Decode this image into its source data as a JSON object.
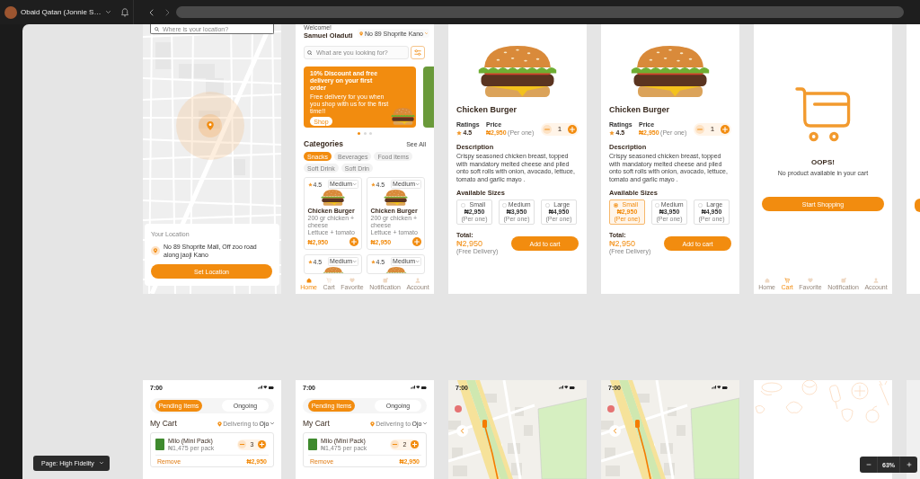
{
  "top_bar": {
    "account_name": "Obaid Qatan (Jonnie S…"
  },
  "top_row": [
    {
      "kind": "location",
      "search": {
        "placeholder": "Where is your location?"
      },
      "card": {
        "label": "Your Location",
        "address": "No 89 Shoprite Mall, Off zoo road along jaoji Kano",
        "button": "Set Location"
      }
    },
    {
      "kind": "home",
      "greeting": "Welcome!",
      "user_name": "Samuel Oladuti",
      "location": "No 89 Shoprite Kano",
      "search": {
        "placeholder": "What are you looking for?"
      },
      "banner": {
        "title": "10% Discount and free delivery on your first order",
        "subtitle": "Free delivery for you when you shop with us for the first time!!",
        "button": "Shop"
      },
      "banner_dots": [
        {
          "selected": true
        },
        {
          "selected": false
        },
        {
          "selected": false
        }
      ],
      "section_title": "Categories",
      "see_all": "See All",
      "categories": [
        {
          "label": "Snacks",
          "selected": true
        },
        {
          "label": "Beverages",
          "selected": false
        },
        {
          "label": "Food items",
          "selected": false
        },
        {
          "label": "Soft Drink",
          "selected": false
        },
        {
          "label": "Soft Drin",
          "selected": false
        }
      ],
      "products": [
        {
          "rating": "4.5",
          "size": "Medium",
          "name": "Chicken Burger",
          "details": [
            "200 gr chicken + cheese",
            "Lettuce + tomato"
          ],
          "price": "₦2,950"
        },
        {
          "rating": "4.5",
          "size": "Medium",
          "name": "Chicken Burger",
          "details": [
            "200 gr chicken + cheese",
            "Lettuce + tomato"
          ],
          "price": "₦2,950"
        },
        {
          "rating": "4.5",
          "size": "Medium"
        },
        {
          "rating": "4.5",
          "size": "Medium"
        }
      ],
      "nav": [
        {
          "label": "Home",
          "selected": true
        },
        {
          "label": "Cart",
          "selected": false
        },
        {
          "label": "Favorite",
          "selected": false
        },
        {
          "label": "Notification",
          "selected": false
        },
        {
          "label": "Account",
          "selected": false
        }
      ]
    },
    {
      "kind": "detail",
      "name": "Chicken Burger",
      "ratings_label": "Ratings",
      "rating": "4.5",
      "price_label": "Price",
      "price": "₦2,950",
      "price_unit": "(Per one)",
      "quantity": "1",
      "description_title": "Description",
      "description": "Crispy seasoned chicken breast, topped with mandatory melted cheese and piled onto soft rolls with onion, avocado, lettuce, tomato and garlic mayo .",
      "sizes_title": "Available Sizes",
      "sizes": [
        {
          "label": "Small",
          "price": "₦2,950",
          "unit": "(Per one)",
          "selected": false
        },
        {
          "label": "Medium",
          "price": "₦3,950",
          "unit": "(Per one)",
          "selected": false
        },
        {
          "label": "Large",
          "price": "₦4,950",
          "unit": "(Per one)",
          "selected": false
        }
      ],
      "total_label": "Total:",
      "total": "₦2,950",
      "delivery_note": "(Free Delivery)",
      "button": "Add to cart"
    },
    {
      "kind": "detail",
      "name": "Chicken Burger",
      "ratings_label": "Ratings",
      "rating": "4.5",
      "price_label": "Price",
      "price": "₦2,950",
      "price_unit": "(Per one)",
      "quantity": "1",
      "description_title": "Description",
      "description": "Crispy seasoned chicken breast, topped with mandatory melted cheese and piled onto soft rolls with onion, avocado, lettuce, tomato and garlic mayo .",
      "sizes_title": "Available Sizes",
      "sizes": [
        {
          "label": "Small",
          "price": "₦2,950",
          "unit": "(Per one)",
          "selected": true
        },
        {
          "label": "Medium",
          "price": "₦3,950",
          "unit": "(Per one)",
          "selected": false
        },
        {
          "label": "Large",
          "price": "₦4,950",
          "unit": "(Per one)",
          "selected": false
        }
      ],
      "total_label": "Total:",
      "total": "₦2,950",
      "delivery_note": "(Free Delivery)",
      "button": "Add to cart"
    },
    {
      "kind": "empty_cart",
      "title": "OOPS!",
      "message": "No product available in your cart",
      "button": "Start Shopping",
      "nav": [
        {
          "label": "Home",
          "selected": false
        },
        {
          "label": "Cart",
          "selected": true
        },
        {
          "label": "Favorite",
          "selected": false
        },
        {
          "label": "Notification",
          "selected": false
        },
        {
          "label": "Account",
          "selected": false
        }
      ]
    },
    {
      "kind": "edge_button"
    }
  ],
  "bottom_row": [
    {
      "kind": "cart",
      "time": "7:00",
      "tabs": [
        {
          "label": "Pending Items",
          "selected": true
        },
        {
          "label": "Ongoing",
          "selected": false
        }
      ],
      "title": "My Cart",
      "delivery_label": "Delivering to",
      "delivery_place": "Ojo",
      "items": [
        {
          "name": "Milo (Mini Pack)",
          "unit_price": "₦1,475 per pack",
          "quantity": "3",
          "remove": "Remove",
          "total": "₦2,950"
        }
      ]
    },
    {
      "kind": "cart",
      "time": "7:00",
      "tabs": [
        {
          "label": "Pending Items",
          "selected": true
        },
        {
          "label": "Ongoing",
          "selected": false
        }
      ],
      "title": "My Cart",
      "delivery_label": "Delivering to",
      "delivery_place": "Ojo",
      "items": [
        {
          "name": "Milo (Mini Pack)",
          "unit_price": "₦1,475 per pack",
          "quantity": "2",
          "remove": "Remove",
          "total": "₦2,950"
        }
      ]
    },
    {
      "kind": "tracking",
      "time": "7:00"
    },
    {
      "kind": "tracking",
      "time": "7:00"
    },
    {
      "kind": "splash"
    },
    {
      "kind": "edge_blank"
    }
  ],
  "page_menu": {
    "label": "Page: High Fidelity"
  },
  "zoom_control": {
    "value": "63%"
  }
}
